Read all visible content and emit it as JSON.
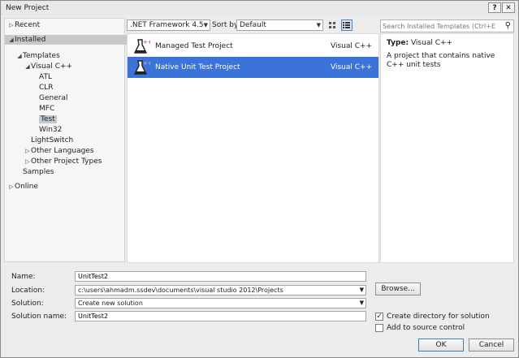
{
  "window": {
    "title": "New Project"
  },
  "tree": {
    "items": [
      {
        "label": "Recent",
        "expander": "▷",
        "level": 0
      },
      {
        "label": "Installed",
        "expander": "◢",
        "level": 0,
        "selected": true
      },
      {
        "label": "Templates",
        "expander": "◢",
        "level": 1
      },
      {
        "label": "Visual C++",
        "expander": "◢",
        "level": 2
      },
      {
        "label": "ATL",
        "expander": "",
        "level": 3
      },
      {
        "label": "CLR",
        "expander": "",
        "level": 3
      },
      {
        "label": "General",
        "expander": "",
        "level": 3
      },
      {
        "label": "MFC",
        "expander": "",
        "level": 3
      },
      {
        "label": "Test",
        "expander": "",
        "level": 3,
        "highlighted": true
      },
      {
        "label": "Win32",
        "expander": "",
        "level": 3
      },
      {
        "label": "LightSwitch",
        "expander": "",
        "level": 2
      },
      {
        "label": "Other Languages",
        "expander": "▷",
        "level": 2
      },
      {
        "label": "Other Project Types",
        "expander": "▷",
        "level": 2
      },
      {
        "label": "Samples",
        "expander": "",
        "level": 1
      },
      {
        "label": "Online",
        "expander": "▷",
        "level": 0
      }
    ]
  },
  "toolbar": {
    "framework": ".NET Framework 4.5",
    "sort_label": "Sort by:",
    "sort_value": "Default",
    "grid_view_icon": "grid-view-icon",
    "list_view_icon": "list-view-icon"
  },
  "templates": [
    {
      "name": "Managed Test Project",
      "language": "Visual C++",
      "selected": false,
      "icon": "flask-icon"
    },
    {
      "name": "Native Unit Test Project",
      "language": "Visual C++",
      "selected": true,
      "icon": "flask-icon"
    }
  ],
  "search": {
    "placeholder": "Search Installed Templates (Ctrl+E)",
    "icon": "search-icon"
  },
  "details": {
    "type_label": "Type:",
    "type_value": "Visual C++",
    "description": "A project that contains native C++ unit tests"
  },
  "form": {
    "name_label": "Name:",
    "name_value": "UnitTest2",
    "location_label": "Location:",
    "location_value": "c:\\users\\ahmadm.ssdev\\documents\\visual studio 2012\\Projects",
    "solution_label": "Solution:",
    "solution_value": "Create new solution",
    "solution_name_label": "Solution name:",
    "solution_name_value": "UnitTest2",
    "browse_label": "Browse...",
    "create_dir_label": "Create directory for solution",
    "create_dir_checked": true,
    "source_control_label": "Add to source control",
    "source_control_checked": false,
    "ok_label": "OK",
    "cancel_label": "Cancel"
  },
  "colors": {
    "selection": "#3b73d8",
    "accent_border": "#4a7eb5"
  }
}
